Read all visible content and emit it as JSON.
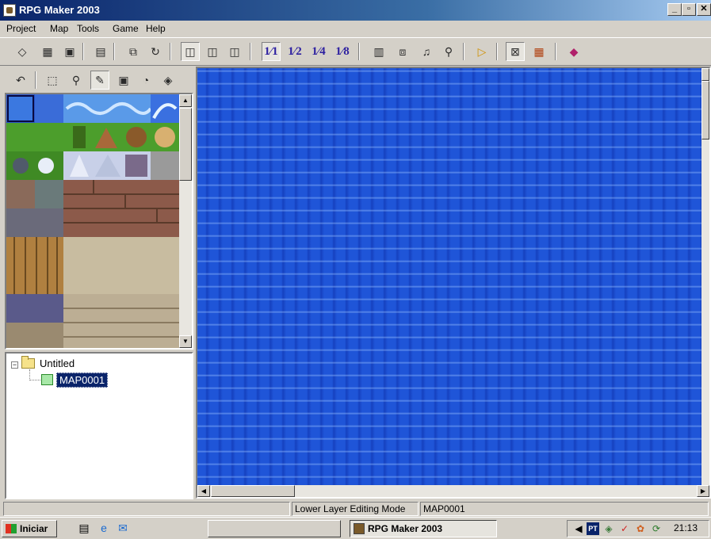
{
  "window": {
    "title": "RPG Maker 2003",
    "min": "_",
    "max": "▫",
    "close": "✕"
  },
  "menu": [
    "Project",
    "Map",
    "Tools",
    "Game",
    "Help"
  ],
  "toolbar": {
    "zoom_1_1": "1⁄1",
    "zoom_1_2": "1⁄2",
    "zoom_1_4": "1⁄4",
    "zoom_1_8": "1⁄8",
    "icons": [
      "new-project-icon",
      "open-project-icon",
      "close-project-icon",
      "save-icon",
      "lower-layer-icon",
      "upper-layer-icon",
      "event-layer-icon",
      "database-icon",
      "material-icon",
      "music-icon",
      "search-icon",
      "play-test-icon",
      "fullscreen-icon",
      "title-screen-icon",
      "help-icon"
    ]
  },
  "draw_tools": {
    "icons": [
      "undo-icon",
      "select-icon",
      "zoom-icon",
      "pencil-icon",
      "rectangle-icon",
      "circle-icon",
      "fill-icon"
    ]
  },
  "tree": {
    "root_label": "Untitled",
    "expander": "−",
    "items": [
      {
        "label": "MAP0001"
      }
    ]
  },
  "status": {
    "cell1": "",
    "mode": "Lower Layer Editing Mode",
    "map": "MAP0001"
  },
  "taskbar": {
    "start": "Iniciar",
    "task": "RPG Maker 2003",
    "lang": "PT",
    "clock": "21:13"
  },
  "colors": {
    "water": "#1f55d8",
    "titlebar_start": "#0a246a",
    "selection": "#0a246a"
  }
}
